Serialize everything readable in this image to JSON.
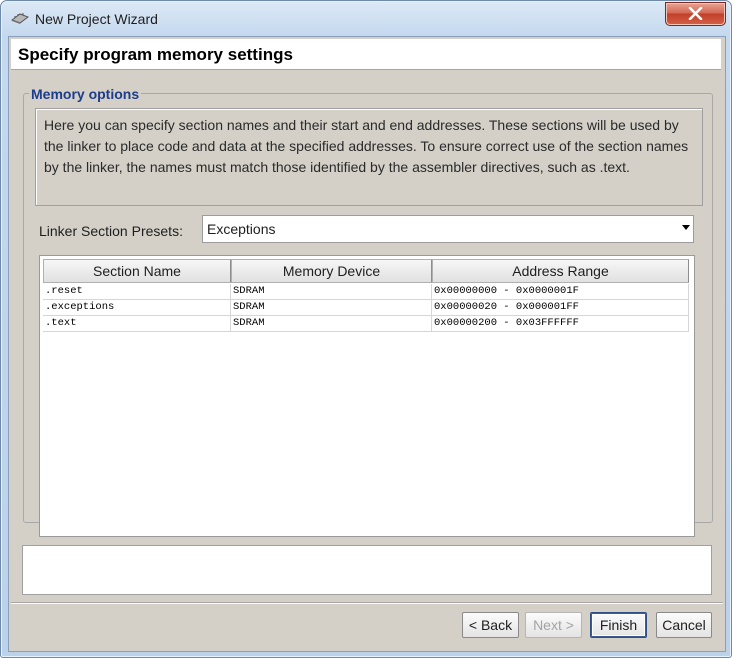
{
  "window": {
    "title": "New Project Wizard",
    "close_label": "close"
  },
  "header": {
    "title": "Specify program memory settings"
  },
  "memory_options": {
    "legend": "Memory options",
    "description": "Here you can specify section names and their start and end addresses. These sections will be used by the linker to place code and data at the specified addresses. To ensure correct use of the section names by the linker, the names must match those identified by the assembler directives, such as .text."
  },
  "presets": {
    "label": "Linker Section Presets:",
    "selected": "Exceptions"
  },
  "table": {
    "columns": [
      "Section Name",
      "Memory Device",
      "Address Range"
    ],
    "rows": [
      [
        ".reset",
        "SDRAM",
        "0x00000000 - 0x0000001F"
      ],
      [
        ".exceptions",
        "SDRAM",
        "0x00000020 - 0x000001FF"
      ],
      [
        ".text",
        "SDRAM",
        "0x00000200 - 0x03FFFFFF"
      ]
    ]
  },
  "buttons": {
    "back": "< Back",
    "next": "Next >",
    "finish": "Finish",
    "cancel": "Cancel"
  },
  "icons": {
    "app": "chip-icon",
    "close": "close-icon"
  },
  "colors": {
    "legend": "#1c3c8c",
    "panel": "#d4d0c8",
    "close_button": "#c24028"
  }
}
